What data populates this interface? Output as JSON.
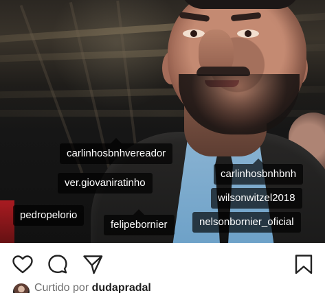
{
  "post": {
    "tags": [
      "carlinhosbnhvereador",
      "ver.giovaniratinho",
      "carlinhosbnhbnh",
      "wilsonwitzel2018",
      "pedropelorio",
      "felipebornier",
      "nelsonbornier_oficial"
    ],
    "likes": {
      "prefix": "Curtido por",
      "user": "dudapradal"
    }
  },
  "icons": {
    "like": "heart-icon",
    "comment": "comment-icon",
    "share": "share-icon",
    "bookmark": "bookmark-icon"
  }
}
